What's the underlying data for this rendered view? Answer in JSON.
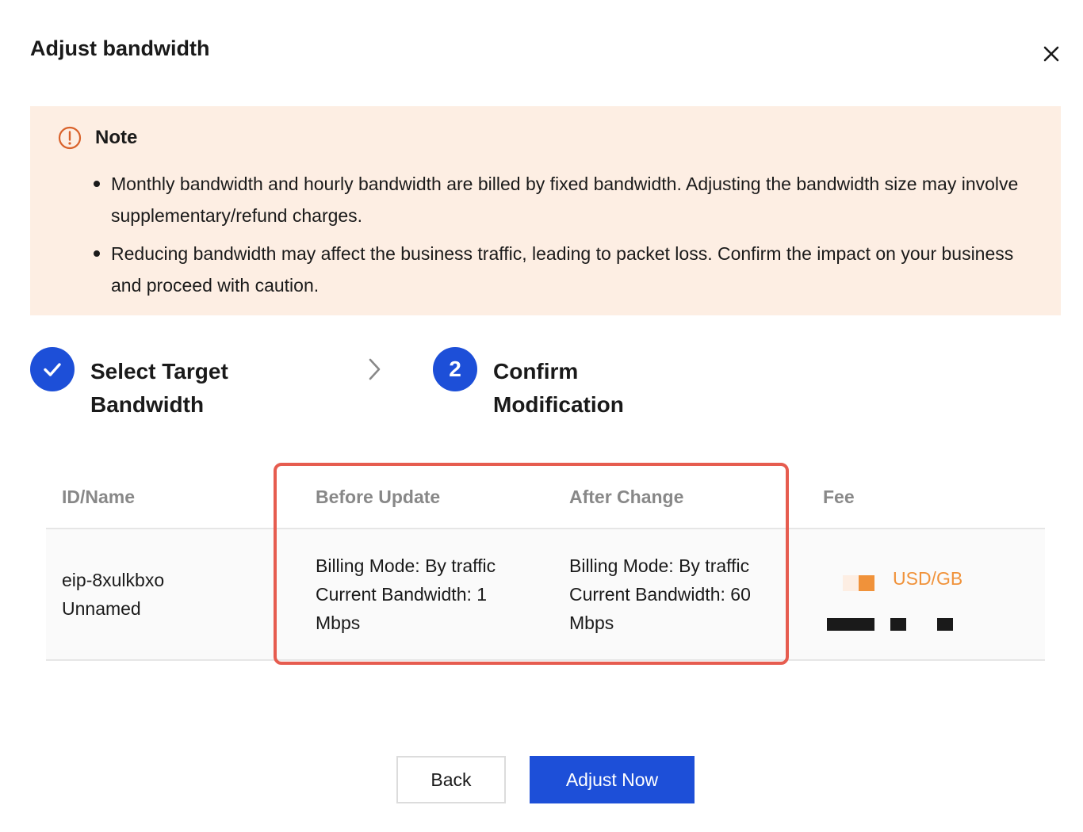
{
  "dialog": {
    "title": "Adjust bandwidth",
    "close_icon": "close-icon"
  },
  "note": {
    "icon": "warning-circle-icon",
    "title": "Note",
    "items": [
      "Monthly bandwidth and hourly bandwidth are billed by fixed bandwidth. Adjusting the bandwidth size may involve supplementary/refund charges.",
      "Reducing bandwidth may affect the business traffic, leading to packet loss. Confirm the impact on your business and proceed with caution."
    ]
  },
  "steps": [
    {
      "icon": "check-icon",
      "label": "Select Target Bandwidth",
      "status": "completed"
    },
    {
      "number": "2",
      "label": "Confirm Modification",
      "status": "active"
    }
  ],
  "step_separator_icon": "chevron-right-icon",
  "table": {
    "headers": {
      "id_name": "ID/Name",
      "before": "Before Update",
      "after": "After Change",
      "fee": "Fee"
    },
    "rows": [
      {
        "id": "eip-8xulkbxo",
        "name": "Unnamed",
        "before": "Billing Mode: By traffic Current Bandwidth: 1 Mbps",
        "after": "Billing Mode: By traffic Current Bandwidth: 60 Mbps",
        "fee_unit": "USD/GB"
      }
    ]
  },
  "colors": {
    "primary": "#1d4fd8",
    "note_bg": "#fdeee3",
    "warning": "#d9622b",
    "fee_accent": "#f0923a",
    "highlight": "#e65c4f"
  },
  "buttons": {
    "back": "Back",
    "confirm": "Adjust Now"
  }
}
